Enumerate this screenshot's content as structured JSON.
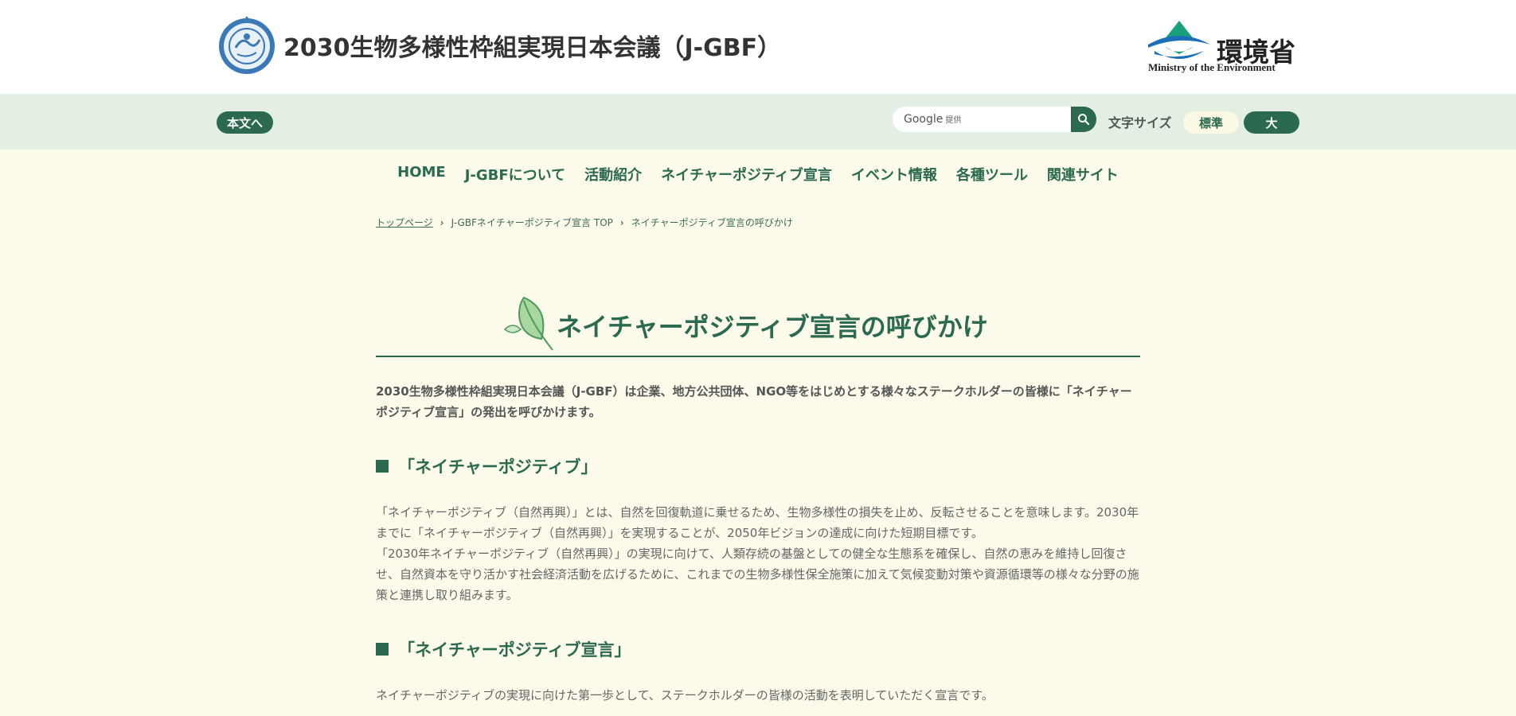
{
  "header": {
    "site_title": "2030生物多様性枠組実現日本会議（J-GBF）",
    "ministry_name": "環境省",
    "ministry_name_en": "Ministry of the Environment"
  },
  "utility": {
    "skip_label": "本文へ",
    "search_brand": "Google",
    "search_brand_suffix": "提供",
    "font_size_label": "文字サイズ",
    "size_standard": "標準",
    "size_large": "大"
  },
  "nav": {
    "items": [
      "HOME",
      "J-GBFについて",
      "活動紹介",
      "ネイチャーポジティブ宣言",
      "イベント情報",
      "各種ツール",
      "関連サイト"
    ]
  },
  "breadcrumb": {
    "items": [
      "トップページ",
      "J-GBFネイチャーポジティブ宣言 TOP",
      "ネイチャーポジティブ宣言の呼びかけ"
    ]
  },
  "main": {
    "title": "ネイチャーポジティブ宣言の呼びかけ",
    "intro": "2030生物多様性枠組実現日本会議（J-GBF）は企業、地方公共団体、NGO等をはじめとする様々なステークホルダーの皆様に「ネイチャーポジティブ宣言」の発出を呼びかけます。",
    "section1_heading": "「ネイチャーポジティブ」",
    "section1_p1": "「ネイチャーポジティブ（自然再興）」とは、自然を回復軌道に乗せるため、生物多様性の損失を止め、反転させることを意味します。2030年までに「ネイチャーポジティブ（自然再興）」を実現することが、2050年ビジョンの達成に向けた短期目標です。",
    "section1_p2": "「2030年ネイチャーポジティブ（自然再興）」の実現に向けて、人類存続の基盤としての健全な生態系を確保し、自然の恵みを維持し回復させ、自然資本を守り活かす社会経済活動を広げるために、これまでの生物多様性保全施策に加えて気候変動対策や資源循環等の様々な分野の施策と連携し取り組みます。",
    "section2_heading": "「ネイチャーポジティブ宣言」",
    "section2_p1": "ネイチャーポジティブの実現に向けた第一歩として、ステークホルダーの皆様の活動を表明していただく宣言です。"
  },
  "colors": {
    "brand_green": "#2b6a50",
    "page_bg": "#fcfaeb",
    "utility_bg": "#e4efe4"
  }
}
